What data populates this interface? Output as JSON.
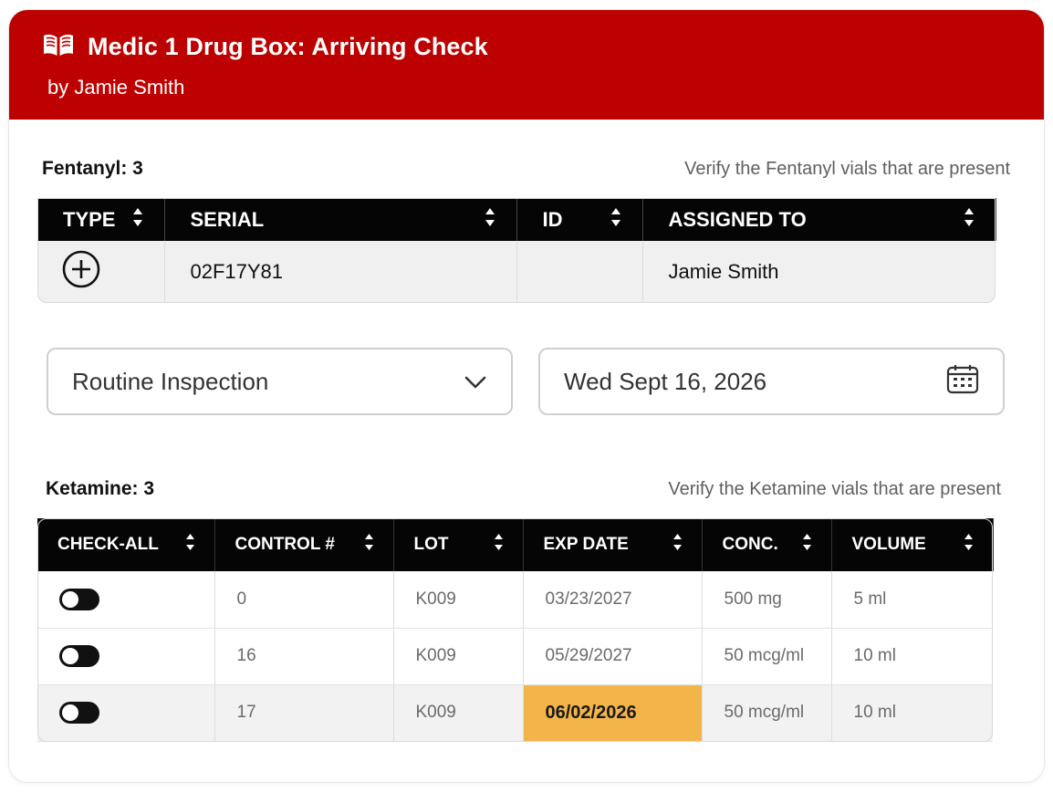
{
  "header": {
    "title": "Medic 1 Drug Box: Arriving Check",
    "subtitle": "by Jamie Smith",
    "icon": "book-open-icon",
    "color": "#bd0000"
  },
  "fentanyl": {
    "title": "Fentanyl: 3",
    "hint": "Verify the Fentanyl vials that are present",
    "columns": [
      "TYPE",
      "SERIAL",
      "ID",
      "ASSIGNED TO"
    ],
    "rows": [
      {
        "type_icon": "plus-circle-icon",
        "serial": "02F17Y81",
        "id": "",
        "assigned_to": "Jamie Smith"
      }
    ]
  },
  "inspection": {
    "type_value": "Routine Inspection",
    "date_value": "Wed Sept 16, 2026"
  },
  "ketamine": {
    "title": "Ketamine: 3",
    "hint": "Verify the Ketamine vials that are present",
    "columns": [
      "CHECK-ALL",
      "CONTROL #",
      "LOT",
      "EXP DATE",
      "CONC.",
      "VOLUME"
    ],
    "rows": [
      {
        "checked": false,
        "control": "0",
        "lot": "K009",
        "exp_date": "03/23/2027",
        "conc": "500 mg",
        "volume": "5 ml",
        "expiring": false
      },
      {
        "checked": false,
        "control": "16",
        "lot": "K009",
        "exp_date": "05/29/2027",
        "conc": "50 mcg/ml",
        "volume": "10 ml",
        "expiring": false
      },
      {
        "checked": false,
        "control": "17",
        "lot": "K009",
        "exp_date": "06/02/2026",
        "conc": "50 mcg/ml",
        "volume": "10 ml",
        "expiring": true
      }
    ],
    "highlight_color": "#f3b54a"
  }
}
